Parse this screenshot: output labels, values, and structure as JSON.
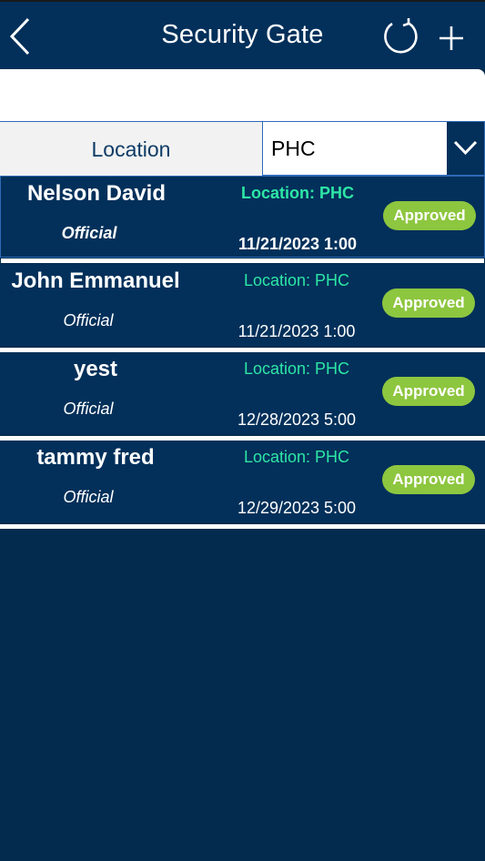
{
  "header": {
    "title": "Security Gate",
    "back_icon": "chevron-left-icon",
    "refresh_icon": "refresh-icon",
    "add_icon": "plus-icon"
  },
  "search": {
    "value": "",
    "placeholder": ""
  },
  "filter": {
    "label": "Location",
    "selected": "PHC",
    "dropdown_icon": "chevron-down-icon"
  },
  "records": [
    {
      "name": "Nelson David",
      "type": "Official",
      "location": "Location: PHC",
      "datetime": "11/21/2023 1:00",
      "status": "Approved"
    },
    {
      "name": "John Emmanuel",
      "type": "Official",
      "location": "Location: PHC",
      "datetime": "11/21/2023 1:00",
      "status": "Approved"
    },
    {
      "name": "yest",
      "type": "Official",
      "location": "Location: PHC",
      "datetime": "12/28/2023 5:00",
      "status": "Approved"
    },
    {
      "name": "tammy fred",
      "type": "Official",
      "location": "Location: PHC",
      "datetime": "12/29/2023 5:00",
      "status": "Approved"
    }
  ],
  "colors": {
    "header_bg": "#02305a",
    "status_approved": "#8dc63f",
    "location_text": "#2ee6a6"
  }
}
